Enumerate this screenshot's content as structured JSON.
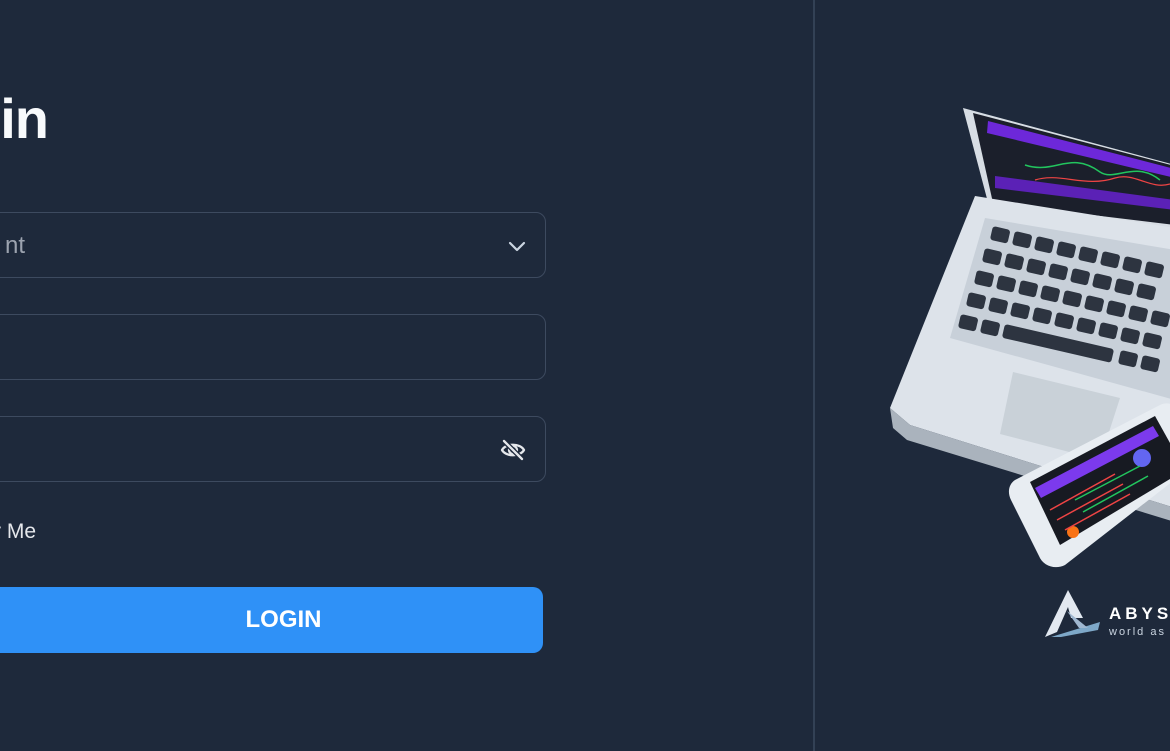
{
  "login_form": {
    "title": "in",
    "account_type_value": "nt",
    "login_value": "",
    "password_value": "",
    "remember_label": "r Me",
    "login_button_label": "LOGIN"
  },
  "icons": {
    "account_dropdown": "chevron-down-icon",
    "password_visibility": "eye-off-icon"
  },
  "branding": {
    "name": "ABYS",
    "tagline": "world as"
  },
  "colors": {
    "background": "#1e293b",
    "primary_button": "#2f91f7",
    "text": "#f8fafc"
  }
}
